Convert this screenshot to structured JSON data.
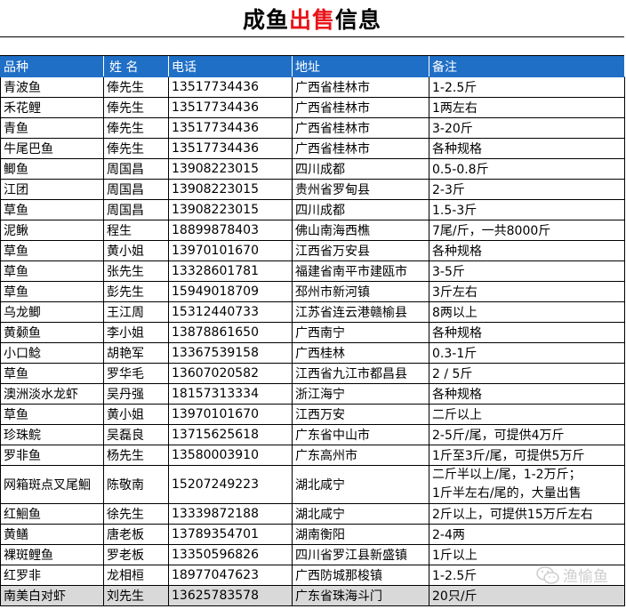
{
  "title": {
    "part1": "成鱼",
    "part2": "出售",
    "part3": "信息"
  },
  "columns": [
    "品种",
    "姓 名",
    "电话",
    "地址",
    "备注"
  ],
  "rows": [
    [
      "青波鱼",
      "俸先生",
      "13517734436",
      "广西省桂林市",
      "1-2.5斤"
    ],
    [
      "禾花鲤",
      "俸先生",
      "13517734436",
      "广西省桂林市",
      "1两左右"
    ],
    [
      "青鱼",
      "俸先生",
      "13517734436",
      "广西省桂林市",
      "3-20斤"
    ],
    [
      "牛尾巴鱼",
      "俸先生",
      "13517734436",
      "广西省桂林市",
      "各种规格"
    ],
    [
      "鲫鱼",
      "周国昌",
      "13908223015",
      "四川成都",
      "0.5-0.8斤"
    ],
    [
      "江团",
      "周国昌",
      "13908223015",
      "贵州省罗甸县",
      "2-3斤"
    ],
    [
      "草鱼",
      "周国昌",
      "13908223015",
      "四川成都",
      "1.5-3斤"
    ],
    [
      "泥鳅",
      "程生",
      "18899878403",
      "佛山南海西樵",
      "7尾/斤，一共8000斤"
    ],
    [
      "草鱼",
      "黄小姐",
      "13970101670",
      "江西省万安县",
      "各种规格"
    ],
    [
      "草鱼",
      "张先生",
      "13328601781",
      "福建省南平市建瓯市",
      "3-5斤"
    ],
    [
      "草鱼",
      "彭先生",
      "15949018709",
      "邳州市新河镇",
      "3斤左右"
    ],
    [
      "乌龙鲫",
      "王江周",
      "15312440733",
      "江苏省连云港赣榆县",
      "8两以上"
    ],
    [
      "黄颡鱼",
      "李小姐",
      "13878861650",
      "广西南宁",
      "各种规格"
    ],
    [
      "小口鲶",
      "胡艳军",
      "13367539158",
      "广西桂林",
      "0.3-1斤"
    ],
    [
      "草鱼",
      "罗华毛",
      "13607020582",
      "江西省九江市都昌县",
      "2 / 5斤"
    ],
    [
      "澳洲淡水龙虾",
      "吴丹强",
      "18157313334",
      "浙江海宁",
      "各种规格"
    ],
    [
      "草鱼",
      "黄小姐",
      "13970101670",
      "江西万安",
      "二斤以上"
    ],
    [
      "珍珠鲩",
      "吴磊良",
      "13715625618",
      "广东省中山市",
      "2-5斤/尾，可提供4万斤"
    ],
    [
      "罗非鱼",
      "杨先生",
      "13580003910",
      "广东高州市",
      "1斤至3斤/尾，可提供5万斤"
    ],
    [
      "网箱斑点叉尾鮰",
      "陈敬南",
      "15207249223",
      "湖北咸宁",
      "二斤半以上/尾，1-2万斤；\n1斤半左右/尾的，大量出售"
    ],
    [
      "红鮰鱼",
      "徐先生",
      "13339872188",
      "湖北咸宁",
      "2斤以上，可提供15万斤左右"
    ],
    [
      "黄鳝",
      "唐老板",
      "13789354701",
      "湖南衡阳",
      "2-4两"
    ],
    [
      "裸斑鲤鱼",
      "罗老板",
      "13350596826",
      "四川省罗江县新盛镇",
      "1斤以上"
    ],
    [
      "红罗非",
      "龙相桓",
      "18977047623",
      "广西防城那梭镇",
      "1-2.5斤"
    ],
    [
      "南美白对虾",
      "刘先生",
      "13625783578",
      "广东省珠海斗门",
      "20只/斤"
    ]
  ],
  "watermark": {
    "text": "渔愉鱼",
    "icon": "wechat-icon"
  },
  "colors": {
    "header_bg": "#1f6fc6",
    "title_highlight": "#e8141a",
    "last_row_bg": "#d9d9d9"
  }
}
